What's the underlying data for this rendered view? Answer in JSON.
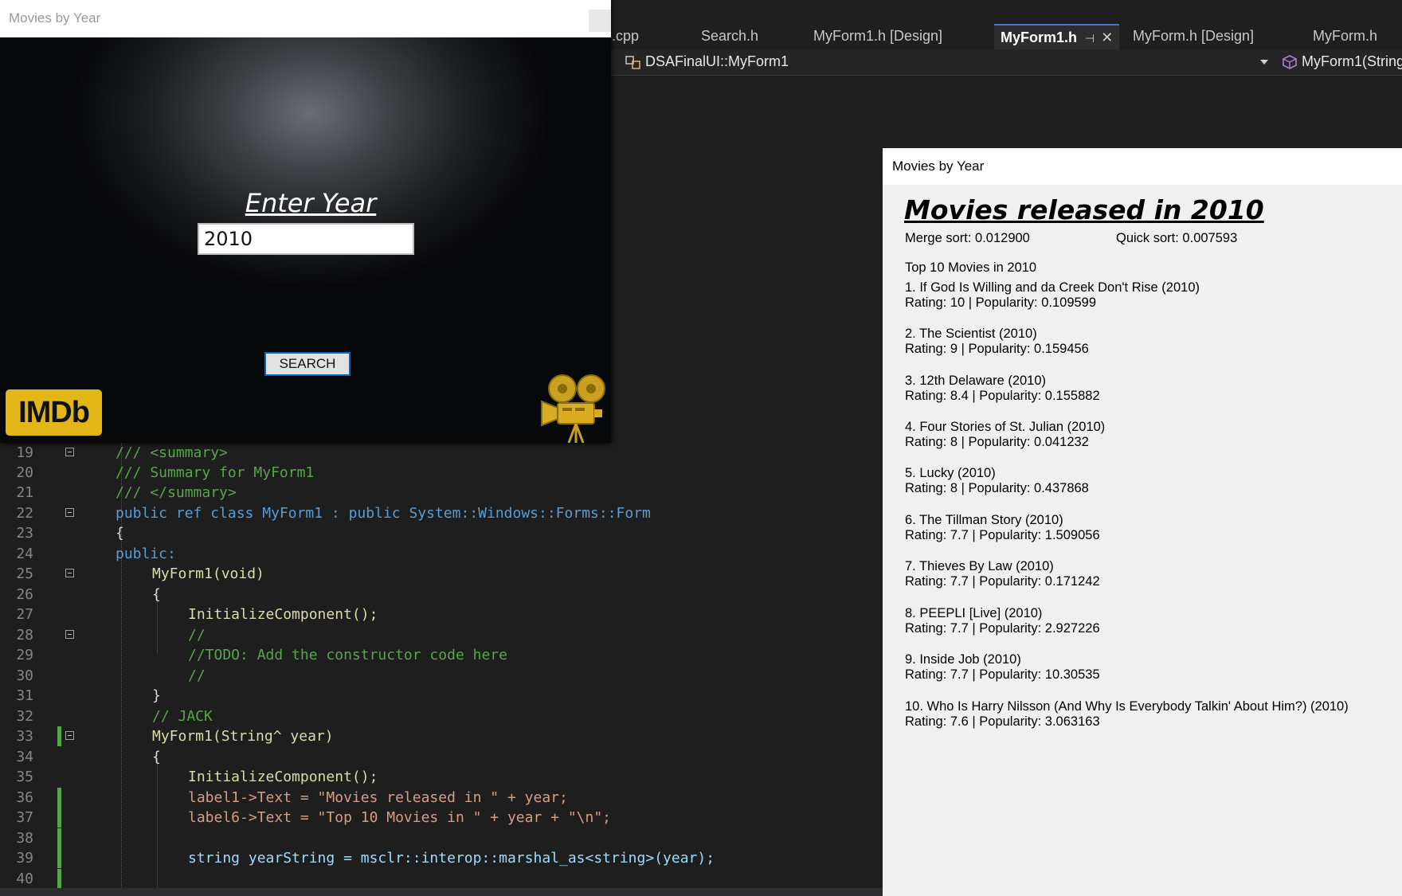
{
  "vs": {
    "tabs": [
      {
        "label": ".cpp"
      },
      {
        "label": "Search.h"
      },
      {
        "label": "MyForm1.h [Design]"
      },
      {
        "label": "MyForm1.h",
        "pin": "⊣",
        "close": "✕"
      },
      {
        "label": "MyForm.h [Design]"
      },
      {
        "label": "MyForm.h"
      }
    ],
    "nav": {
      "scope": "DSAFinalUI::MyForm1",
      "member": "MyForm1(String"
    },
    "code_lines": [
      {
        "num": "19",
        "text": "/// <summary>"
      },
      {
        "num": "20",
        "text": "/// Summary for MyForm1"
      },
      {
        "num": "21",
        "text": "/// </summary>"
      },
      {
        "num": "22",
        "text": "public ref class MyForm1 : public System::Windows::Forms::Form"
      },
      {
        "num": "23",
        "text": "{"
      },
      {
        "num": "24",
        "text": "public:"
      },
      {
        "num": "25",
        "text": "MyForm1(void)"
      },
      {
        "num": "26",
        "text": "{"
      },
      {
        "num": "27",
        "text": "InitializeComponent();"
      },
      {
        "num": "28",
        "text": "//"
      },
      {
        "num": "29",
        "text": "//TODO: Add the constructor code here"
      },
      {
        "num": "30",
        "text": "//"
      },
      {
        "num": "31",
        "text": "}"
      },
      {
        "num": "32",
        "text": "// JACK"
      },
      {
        "num": "33",
        "text": "MyForm1(String^ year)"
      },
      {
        "num": "34",
        "text": "{"
      },
      {
        "num": "35",
        "text": "InitializeComponent();"
      },
      {
        "num": "36",
        "text": "label1->Text = \"Movies released in \" + year;"
      },
      {
        "num": "37",
        "text": "label6->Text = \"Top 10 Movies in \" + year + \"\\n\";"
      },
      {
        "num": "38",
        "text": ""
      },
      {
        "num": "39",
        "text": "string yearString = msclr::interop::marshal_as<string>(year);"
      },
      {
        "num": "40",
        "text": ""
      }
    ]
  },
  "search_window": {
    "title": "Movies by Year",
    "prompt": "Enter Year",
    "year_value": "2010",
    "search_label": "SEARCH",
    "logo_text": "IMDb"
  },
  "results_window": {
    "title": "Movies by Year",
    "heading": "Movies released in 2010",
    "merge_sort": "Merge sort: 0.012900",
    "quick_sort": "Quick sort:  0.007593",
    "top10_title": "Top 10 Movies in 2010",
    "movies": [
      {
        "title": "1. If God Is Willing and da Creek Don't Rise (2010)",
        "stats": "Rating: 10  |  Popularity: 0.109599"
      },
      {
        "title": "2. The Scientist (2010)",
        "stats": "Rating: 9  |  Popularity: 0.159456"
      },
      {
        "title": "3. 12th  Delaware (2010)",
        "stats": "Rating: 8.4  |  Popularity: 0.155882"
      },
      {
        "title": "4. Four Stories of St. Julian (2010)",
        "stats": "Rating: 8  |  Popularity: 0.041232"
      },
      {
        "title": "5. Lucky (2010)",
        "stats": "Rating: 8  |  Popularity: 0.437868"
      },
      {
        "title": "6. The Tillman Story (2010)",
        "stats": "Rating: 7.7  |  Popularity: 1.509056"
      },
      {
        "title": "7. Thieves By Law (2010)",
        "stats": "Rating: 7.7  |  Popularity: 0.171242"
      },
      {
        "title": "8. PEEPLI [Live] (2010)",
        "stats": "Rating: 7.7  |  Popularity: 2.927226"
      },
      {
        "title": "9. Inside Job (2010)",
        "stats": "Rating: 7.7  |  Popularity: 10.30535"
      },
      {
        "title": "10. Who Is Harry Nilsson (And Why Is Everybody Talkin' About Him?) (2010)",
        "stats": "Rating: 7.6  |  Popularity: 3.063163"
      }
    ]
  },
  "colors": {
    "imdb_gold": "#e2b616",
    "vs_background": "#1e1e1e",
    "comment_green": "#57a64a",
    "keyword_blue": "#569cd6",
    "type_teal": "#4ec9b0",
    "string_orange": "#d69d85"
  }
}
